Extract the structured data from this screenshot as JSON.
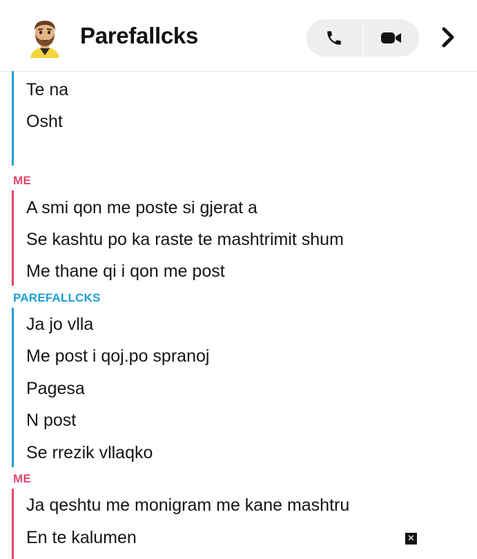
{
  "header": {
    "title": "Parefallcks",
    "icons": {
      "avatar": "bitmoji-avatar",
      "call": "phone-icon",
      "video": "video-camera-icon",
      "next": "chevron-right-icon"
    }
  },
  "thread": {
    "group0": {
      "lines": [
        "Te na",
        "Osht"
      ]
    },
    "group1": {
      "sender": "ME",
      "lines": [
        "A smi qon me poste si gjerat a",
        "Se kashtu po ka raste te mashtrimit shum",
        "Me thane qi i qon me post"
      ]
    },
    "group2": {
      "sender": "PAREFALLCKS",
      "lines": [
        "Ja jo vlla",
        "Me post i qoj.po spranoj",
        "Pagesa",
        "N post",
        "Se rrezik vllaqko"
      ]
    },
    "group3": {
      "sender": "ME",
      "lines": [
        "Ja qeshtu me monigram me kane mashtru",
        "En te kalumen"
      ]
    }
  },
  "colors": {
    "me": "#e0466b",
    "them": "#1a9fd6"
  },
  "overlay": {
    "close": "✕"
  }
}
